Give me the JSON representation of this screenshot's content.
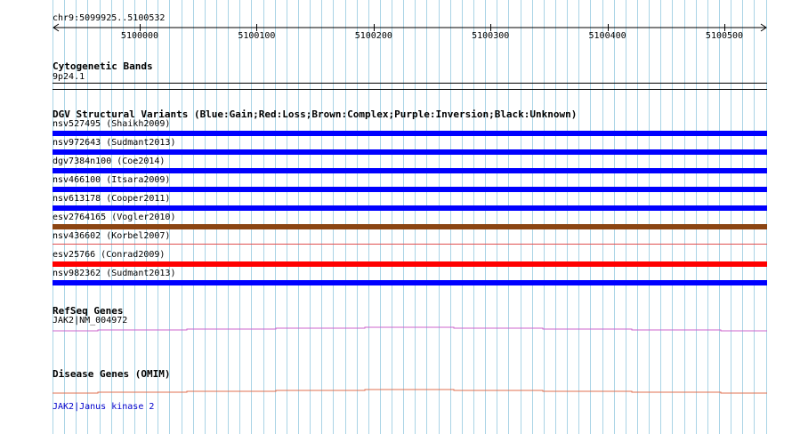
{
  "ruler": {
    "region": "chr9:5099925..5100532",
    "ticks": [
      "5100000",
      "5100100",
      "5100200",
      "5100300",
      "5100400",
      "5100500"
    ]
  },
  "tracks": {
    "cytoband": {
      "title": "Cytogenetic Bands",
      "band": "9p24.1"
    },
    "dgv": {
      "title": "DGV Structural Variants (Blue:Gain;Red:Loss;Brown:Complex;Purple:Inversion;Black:Unknown)",
      "variants": [
        {
          "label": "nsv527495 (Shaikh2009)",
          "color": "#0000ff",
          "thin": false
        },
        {
          "label": "nsv972643 (Sudmant2013)",
          "color": "#0000ff",
          "thin": false
        },
        {
          "label": "dgv7384n100 (Coe2014)",
          "color": "#0000ff",
          "thin": false
        },
        {
          "label": "nsv466100 (Itsara2009)",
          "color": "#0000ff",
          "thin": false
        },
        {
          "label": "nsv613178 (Cooper2011)",
          "color": "#0000ff",
          "thin": false
        },
        {
          "label": "esv2764165 (Vogler2010)",
          "color": "#8b4513",
          "thin": false
        },
        {
          "label": "nsv436602 (Korbel2007)",
          "color": "#e05050",
          "thin": true
        },
        {
          "label": "esv25766 (Conrad2009)",
          "color": "#ff0000",
          "thin": false
        },
        {
          "label": "nsv982362 (Sudmant2013)",
          "color": "#0000ff",
          "thin": false
        }
      ]
    },
    "refseq": {
      "title": "RefSeq Genes",
      "gene": "JAK2|NM_004972",
      "color": "#cc66cc"
    },
    "omim": {
      "title": "Disease Genes (OMIM)",
      "gene": "JAK2|Janus kinase 2",
      "color": "#e07050",
      "link_color": "#0000cc"
    }
  },
  "colors": {
    "grid": "#aad4e6"
  }
}
